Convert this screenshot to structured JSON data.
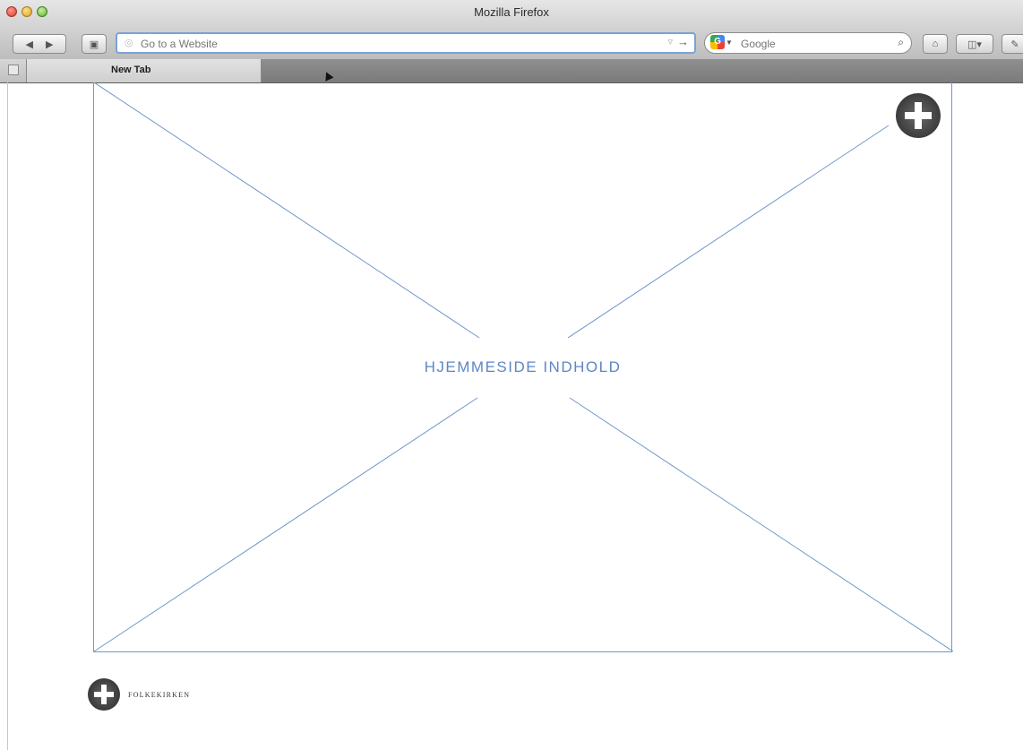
{
  "window": {
    "title": "Mozilla Firefox"
  },
  "toolbar": {
    "back_icon": "back-arrow-icon",
    "forward_icon": "forward-arrow-icon",
    "url_placeholder": "Go to a Website",
    "search_engine": "Google",
    "search_placeholder": "Google"
  },
  "tabs": [
    {
      "label": "New Tab",
      "active": true
    }
  ],
  "page": {
    "placeholder_label": "HJEMMESIDE INDHOLD",
    "brand_text": "FOLKEKIRKEN",
    "placeholder_color": "#6f97cc"
  }
}
